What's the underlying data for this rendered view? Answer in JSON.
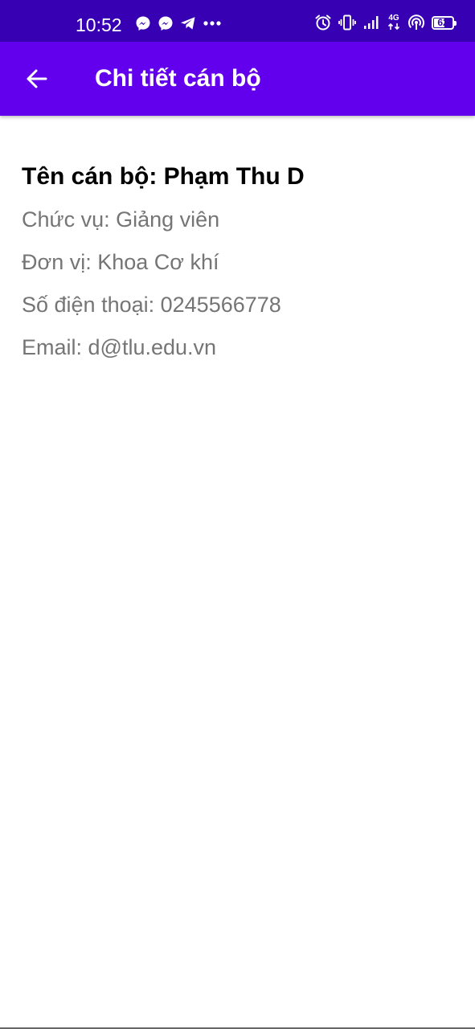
{
  "status_bar": {
    "time": "10:52",
    "battery_level": "62",
    "battery_percent": 62,
    "network_label": "4G",
    "left_icons": [
      "messenger-icon",
      "messenger-icon",
      "telegram-icon",
      "more-notifications-icon"
    ],
    "right_icons": [
      "alarm-icon",
      "vibrate-icon",
      "signal-icon",
      "network-4g-icon",
      "hotspot-icon",
      "battery-icon"
    ]
  },
  "app_bar": {
    "title": "Chi tiết cán bộ",
    "back_icon": "arrow-back-icon"
  },
  "details": {
    "name": "Tên cán bộ: Phạm Thu D",
    "position": "Chức vụ: Giảng viên",
    "unit": "Đơn vị: Khoa Cơ khí",
    "phone": "Số điện thoại: 0245566778",
    "email": "Email: d@tlu.edu.vn"
  },
  "colors": {
    "status_bar": "#3700b3",
    "app_bar": "#6200ee",
    "name_text": "#000000",
    "detail_text": "#757575",
    "background": "#ffffff"
  }
}
